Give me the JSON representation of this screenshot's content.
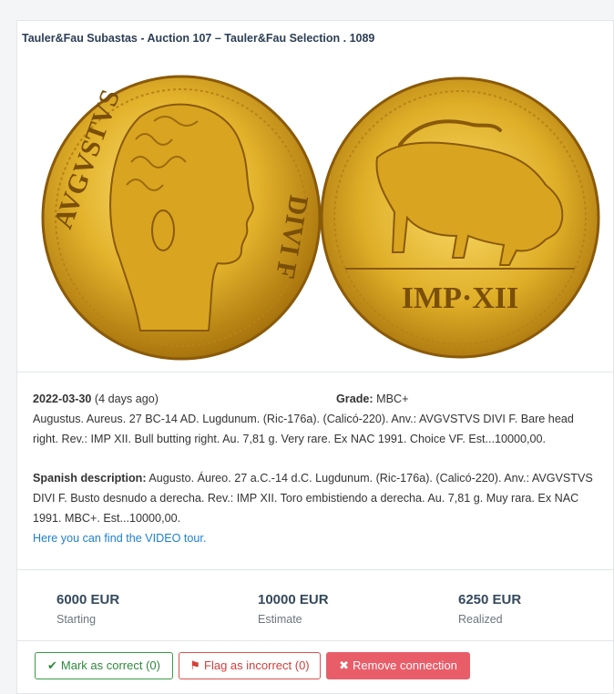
{
  "header": {
    "title": "Tauler&Fau Subastas - Auction 107 – Tauler&Fau Selection . 1089"
  },
  "coins": {
    "obverse_legend_left": "AVGVSTVS",
    "obverse_legend_right": "DIVI F",
    "reverse_legend": "IMP·XII"
  },
  "lot": {
    "date": "2022-03-30",
    "date_relative": "(4 days ago)",
    "grade_label": "Grade:",
    "grade_value": "MBC+",
    "description": "Augustus. Aureus. 27 BC-14 AD. Lugdunum. (Ric-176a). (Calicó-220). Anv.: AVGVSTVS DIVI F. Bare head right. Rev.: IMP XII. Bull butting right. Au. 7,81 g. Very rare. Ex NAC 1991. Choice VF. Est...10000,00.",
    "spanish_label": "Spanish description:",
    "spanish_text": "Augusto. Áureo. 27 a.C.-14 d.C. Lugdunum. (Ric-176a). (Calicó-220). Anv.: AVGVSTVS DIVI F. Busto desnudo a derecha. Rev.: IMP XII. Toro embistiendo a derecha. Au. 7,81 g. Muy rara. Ex NAC 1991. MBC+. Est...10000,00.",
    "video_link": "Here you can find the VIDEO tour."
  },
  "stats": [
    {
      "value": "6000 EUR",
      "caption": "Starting"
    },
    {
      "value": "10000 EUR",
      "caption": "Estimate"
    },
    {
      "value": "6250 EUR",
      "caption": "Realized"
    }
  ],
  "actions": {
    "mark_correct": "Mark as correct (0)",
    "flag_incorrect": "Flag as incorrect (0)",
    "remove_connection": "Remove connection"
  },
  "colors": {
    "gold": "#d9a520",
    "gold_dark": "#8a5a0a",
    "link": "#1e7fd0",
    "success": "#2f8a3c",
    "danger": "#d9534f"
  }
}
